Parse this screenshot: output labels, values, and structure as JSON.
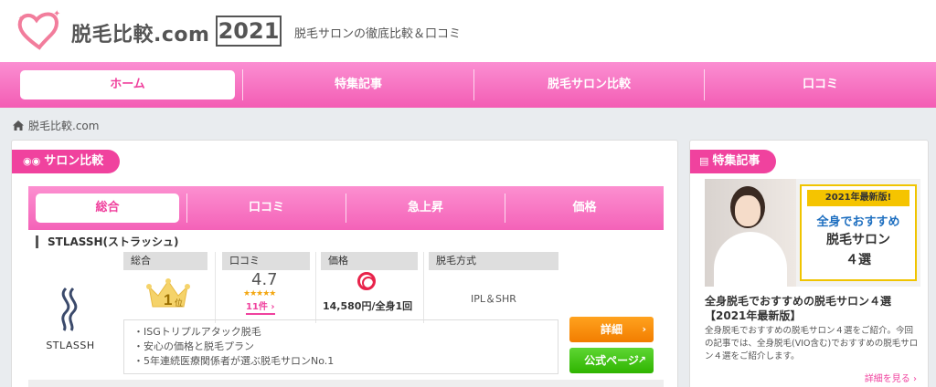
{
  "header": {
    "site_title": "脱毛比較.com",
    "year": "2021",
    "tagline": "脱毛サロンの徹底比較＆口コミ"
  },
  "nav": {
    "items": [
      {
        "label": "ホーム"
      },
      {
        "label": "特集記事"
      },
      {
        "label": "脱毛サロン比較"
      },
      {
        "label": "口コミ"
      }
    ]
  },
  "breadcrumb": {
    "home": "脱毛比較.com"
  },
  "main": {
    "section_label": "サロン比較",
    "tabs": [
      {
        "label": "総合"
      },
      {
        "label": "口コミ"
      },
      {
        "label": "急上昇"
      },
      {
        "label": "価格"
      }
    ],
    "item": {
      "name": "STLASSH(ストラッシュ)",
      "brand": "STLASSH",
      "columns": {
        "overall": "総合",
        "reviews": "口コミ",
        "price": "価格",
        "method": "脱毛方式"
      },
      "rank": "1",
      "rank_suffix": "位",
      "rating": "4.7",
      "stars": "★★★★★",
      "review_count": "11件 ›",
      "price": "14,580円/全身1回",
      "method": "IPL＆SHR",
      "features": [
        "ISGトリプルアタック脱毛",
        "安心の価格と脱毛プラン",
        "5年連続医療関係者が選ぶ脱毛サロンNo.1"
      ],
      "detail_button": "詳細",
      "official_button": "公式ページ"
    }
  },
  "sidebar": {
    "section_label": "特集記事",
    "promo": {
      "badge": "2021年最新版!",
      "line1": "全身でおすすめ",
      "line2": "脱毛サロン",
      "line3": "４選"
    },
    "article_title": "全身脱毛でおすすめの脱毛サロン４選【2021年最新版】",
    "article_desc": "全身脱毛でおすすめの脱毛サロン４選をご紹介。今回の記事では、全身脱毛(VIO含む)でおすすめの脱毛サロン４選をご紹介します。",
    "more_link": "詳細を見る ›"
  },
  "colors": {
    "accent": "#f0429e",
    "nav_gradient_top": "#fb8ed2",
    "detail_button": "#f27d00",
    "official_button": "#2fb400"
  },
  "icons": [
    "heart-logo-icon",
    "home-icon",
    "gamepad-icon",
    "newspaper-icon",
    "crown-icon",
    "double-circle-icon",
    "chevron-right-icon",
    "external-link-icon"
  ]
}
